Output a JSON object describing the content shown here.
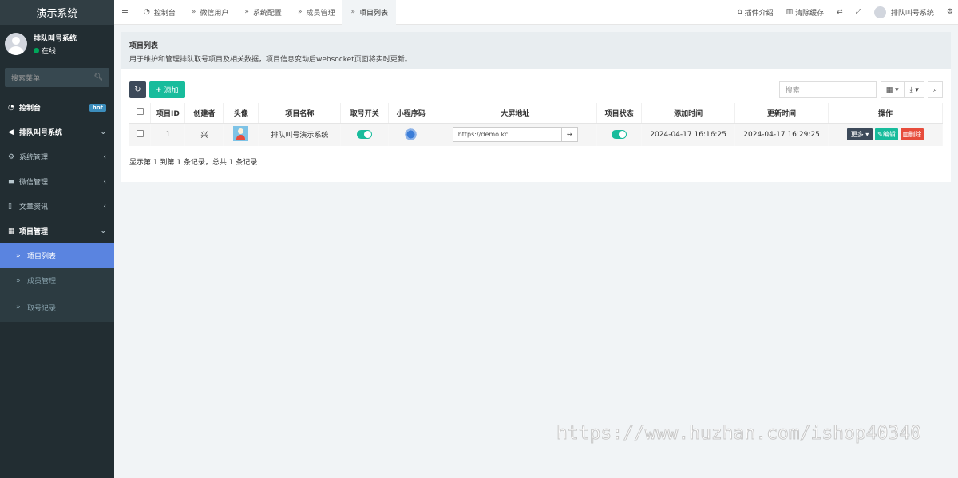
{
  "sidebar": {
    "title": "演示系统",
    "user": {
      "name": "排队叫号系统",
      "status": "在线"
    },
    "search_placeholder": "搜索菜单",
    "items": [
      {
        "label": "控制台",
        "badge": "hot",
        "icon": "dashboard-icon"
      },
      {
        "label": "排队叫号系统",
        "icon": "megaphone-icon",
        "expanded": true
      },
      {
        "label": "系统管理",
        "icon": "gears-icon"
      },
      {
        "label": "微信管理",
        "icon": "chat-icon"
      },
      {
        "label": "文章资讯",
        "icon": "file-icon"
      },
      {
        "label": "项目管理",
        "icon": "grid-icon",
        "expanded": true
      }
    ],
    "submenu": [
      {
        "label": "项目列表",
        "active": true
      },
      {
        "label": "成员管理"
      },
      {
        "label": "取号记录"
      }
    ]
  },
  "topbar": {
    "tabs": [
      {
        "label": "控制台",
        "icon": "dashboard-icon"
      },
      {
        "label": "微信用户",
        "icon": "chevron-double-right-icon"
      },
      {
        "label": "系统配置",
        "icon": "chevron-double-right-icon"
      },
      {
        "label": "成员管理",
        "icon": "chevron-double-right-icon"
      },
      {
        "label": "项目列表",
        "icon": "chevron-double-right-icon",
        "active": true
      }
    ],
    "right": {
      "plugin_intro": "插件介绍",
      "clear_cache": "清除缓存",
      "username": "排队叫号系统"
    }
  },
  "panel": {
    "title": "项目列表",
    "description": "用于维护和管理排队取号项目及相关数据，项目信息变动后websocket页面将实时更新。"
  },
  "toolbar": {
    "add_label": "添加",
    "search_placeholder": "搜索"
  },
  "table": {
    "headers": [
      "项目ID",
      "创建者",
      "头像",
      "项目名称",
      "取号开关",
      "小程序码",
      "大屏地址",
      "项目状态",
      "添加时间",
      "更新时间",
      "操作"
    ],
    "rows": [
      {
        "id": "1",
        "creator": "兴",
        "name": "排队叫号演示系统",
        "queue_switch": true,
        "screen_url": "https://demo.kc",
        "status": true,
        "created": "2024-04-17 16:16:25",
        "updated": "2024-04-17 16:29:25",
        "actions": {
          "more": "更多",
          "edit": "编辑",
          "delete": "删除"
        }
      }
    ]
  },
  "pager_info": "显示第 1 到第 1 条记录，总共 1 条记录",
  "watermark": "https://www.huzhan.com/ishop40340",
  "colors": {
    "sidebar_bg": "#222d32",
    "active_menu": "#5a84e0",
    "accent_green": "#18bc9c",
    "danger": "#e74c3c",
    "dark_btn": "#3d4a5a"
  }
}
